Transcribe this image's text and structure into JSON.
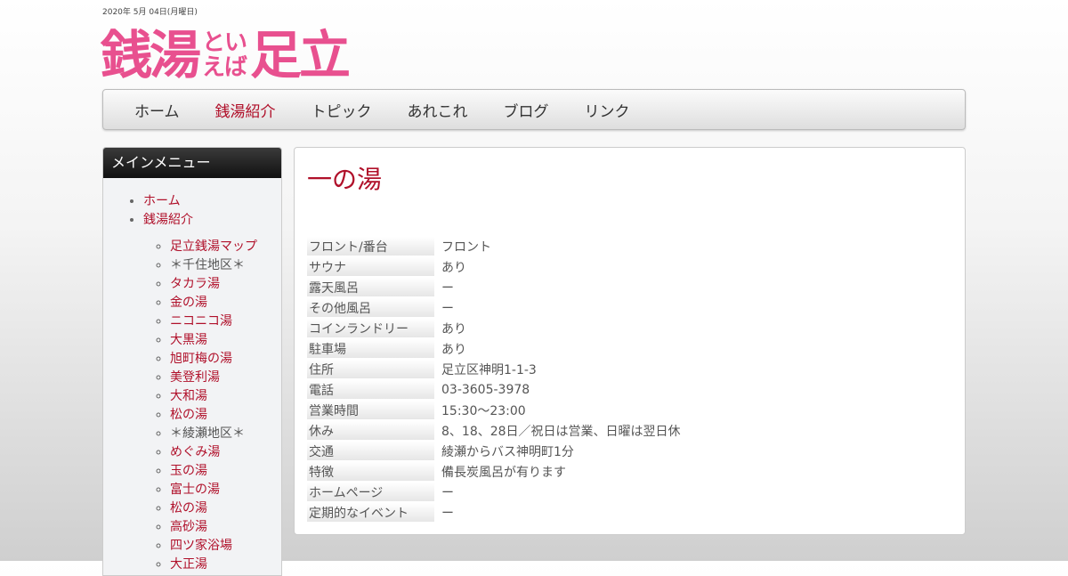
{
  "header": {
    "date": "2020年 5月 04日(月曜日)",
    "logo": {
      "part1": "銭湯",
      "mid_top": "とい",
      "mid_bottom": "えば",
      "part2": "足立"
    }
  },
  "nav": {
    "items": [
      {
        "label": "ホーム"
      },
      {
        "label": "銭湯紹介"
      },
      {
        "label": "トピック"
      },
      {
        "label": "あれこれ"
      },
      {
        "label": "ブログ"
      },
      {
        "label": "リンク"
      }
    ],
    "active_index": 1
  },
  "sidebar": {
    "title": "メインメニュー",
    "top_items": [
      {
        "label": "ホーム"
      },
      {
        "label": "銭湯紹介"
      }
    ],
    "sub_items": [
      {
        "label": "足立銭湯マップ"
      },
      {
        "label": "＊千住地区＊"
      },
      {
        "label": "タカラ湯"
      },
      {
        "label": "金の湯"
      },
      {
        "label": "ニコニコ湯"
      },
      {
        "label": "大黒湯"
      },
      {
        "label": "旭町梅の湯"
      },
      {
        "label": "美登利湯"
      },
      {
        "label": "大和湯"
      },
      {
        "label": "松の湯"
      },
      {
        "label": "＊綾瀬地区＊"
      },
      {
        "label": "めぐみ湯"
      },
      {
        "label": "玉の湯"
      },
      {
        "label": "富士の湯"
      },
      {
        "label": "松の湯"
      },
      {
        "label": "高砂湯"
      },
      {
        "label": "四ツ家浴場"
      },
      {
        "label": "大正湯"
      }
    ]
  },
  "main": {
    "title": "一の湯",
    "rows": [
      {
        "key": "フロント/番台",
        "value": "フロント"
      },
      {
        "key": "サウナ",
        "value": "あり"
      },
      {
        "key": "露天風呂",
        "value": "ー"
      },
      {
        "key": "その他風呂",
        "value": "ー"
      },
      {
        "key": "コインランドリー",
        "value": "あり"
      },
      {
        "key": "駐車場",
        "value": "あり"
      },
      {
        "key": "住所",
        "value": "足立区神明1-1-3"
      },
      {
        "key": "電話",
        "value": "03-3605-3978"
      },
      {
        "key": "営業時間",
        "value": "15:30～23:00"
      },
      {
        "key": "休み",
        "value": "8、18、28日／祝日は営業、日曜は翌日休"
      },
      {
        "key": "交通",
        "value": "綾瀬からバス神明町1分"
      },
      {
        "key": "特徴",
        "value": "備長炭風呂が有ります"
      },
      {
        "key": "ホームページ",
        "value": "ー"
      },
      {
        "key": "定期的なイベント",
        "value": "ー"
      }
    ]
  }
}
